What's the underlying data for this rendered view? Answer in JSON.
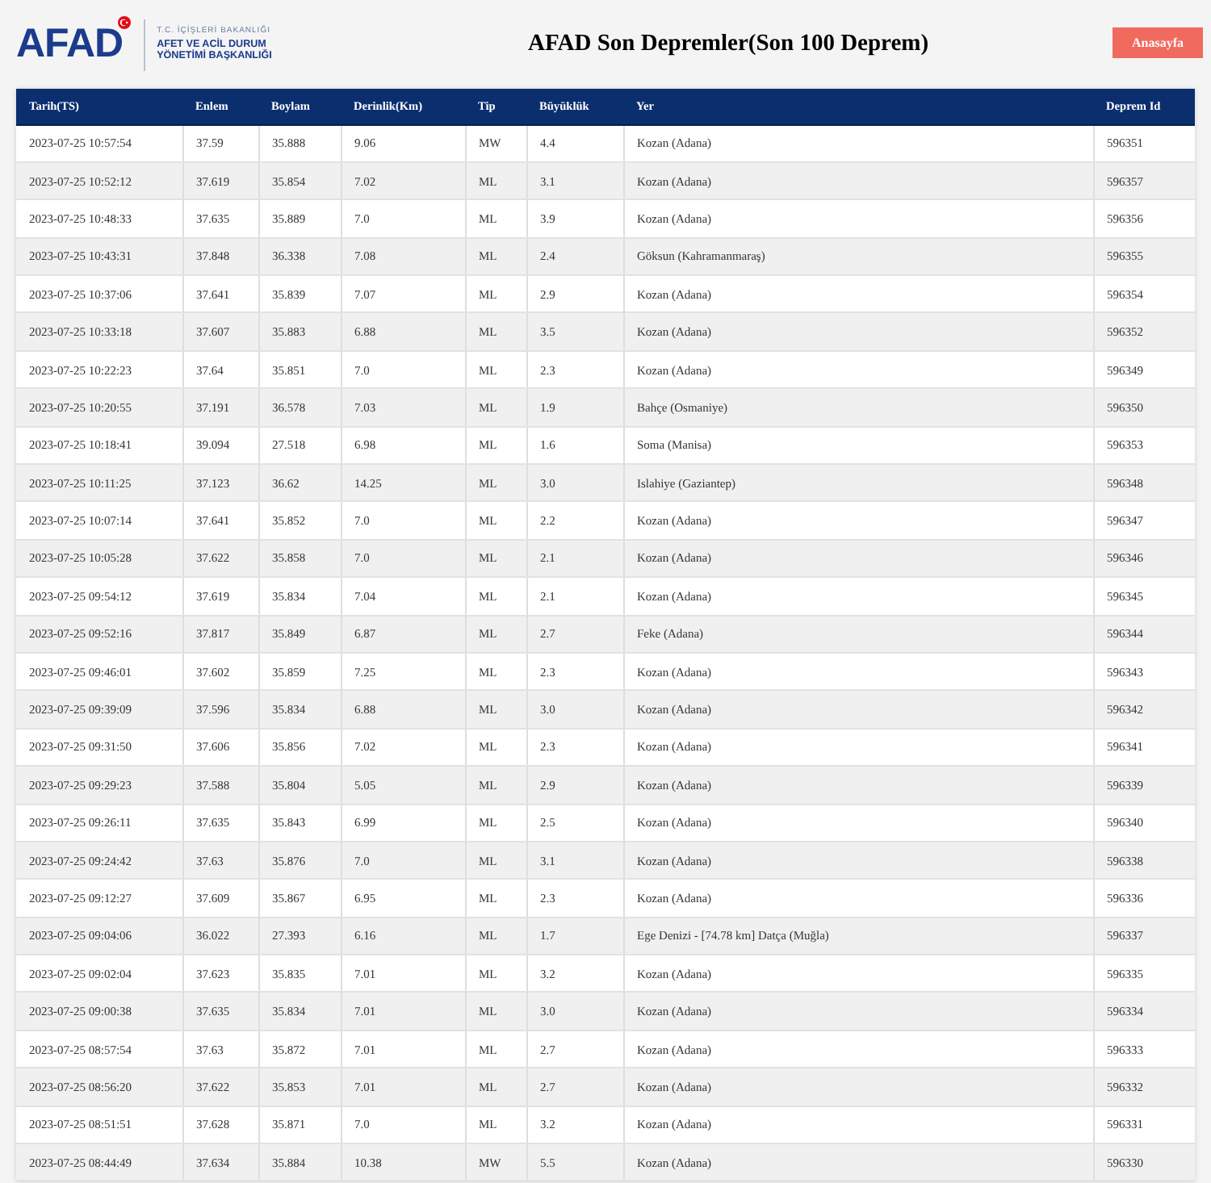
{
  "logo": {
    "wordmark": "AFAD",
    "ministry": "T.C. İÇİŞLERİ BAKANLIĞI",
    "agency": [
      "AFET VE ACİL DURUM",
      "YÖNETİMİ BAŞKANLIĞI"
    ]
  },
  "title": "AFAD Son Depremler(Son 100 Deprem)",
  "home_button": "Anasayfa",
  "table": {
    "columns": [
      "Tarih(TS)",
      "Enlem",
      "Boylam",
      "Derinlik(Km)",
      "Tip",
      "Büyüklük",
      "Yer",
      "Deprem Id"
    ],
    "rows": [
      [
        "2023-07-25 10:57:54",
        "37.59",
        "35.888",
        "9.06",
        "MW",
        "4.4",
        "Kozan (Adana)",
        "596351"
      ],
      [
        "2023-07-25 10:52:12",
        "37.619",
        "35.854",
        "7.02",
        "ML",
        "3.1",
        "Kozan (Adana)",
        "596357"
      ],
      [
        "2023-07-25 10:48:33",
        "37.635",
        "35.889",
        "7.0",
        "ML",
        "3.9",
        "Kozan (Adana)",
        "596356"
      ],
      [
        "2023-07-25 10:43:31",
        "37.848",
        "36.338",
        "7.08",
        "ML",
        "2.4",
        "Göksun (Kahramanmaraş)",
        "596355"
      ],
      [
        "2023-07-25 10:37:06",
        "37.641",
        "35.839",
        "7.07",
        "ML",
        "2.9",
        "Kozan (Adana)",
        "596354"
      ],
      [
        "2023-07-25 10:33:18",
        "37.607",
        "35.883",
        "6.88",
        "ML",
        "3.5",
        "Kozan (Adana)",
        "596352"
      ],
      [
        "2023-07-25 10:22:23",
        "37.64",
        "35.851",
        "7.0",
        "ML",
        "2.3",
        "Kozan (Adana)",
        "596349"
      ],
      [
        "2023-07-25 10:20:55",
        "37.191",
        "36.578",
        "7.03",
        "ML",
        "1.9",
        "Bahçe (Osmaniye)",
        "596350"
      ],
      [
        "2023-07-25 10:18:41",
        "39.094",
        "27.518",
        "6.98",
        "ML",
        "1.6",
        "Soma (Manisa)",
        "596353"
      ],
      [
        "2023-07-25 10:11:25",
        "37.123",
        "36.62",
        "14.25",
        "ML",
        "3.0",
        "Islahiye (Gaziantep)",
        "596348"
      ],
      [
        "2023-07-25 10:07:14",
        "37.641",
        "35.852",
        "7.0",
        "ML",
        "2.2",
        "Kozan (Adana)",
        "596347"
      ],
      [
        "2023-07-25 10:05:28",
        "37.622",
        "35.858",
        "7.0",
        "ML",
        "2.1",
        "Kozan (Adana)",
        "596346"
      ],
      [
        "2023-07-25 09:54:12",
        "37.619",
        "35.834",
        "7.04",
        "ML",
        "2.1",
        "Kozan (Adana)",
        "596345"
      ],
      [
        "2023-07-25 09:52:16",
        "37.817",
        "35.849",
        "6.87",
        "ML",
        "2.7",
        "Feke (Adana)",
        "596344"
      ],
      [
        "2023-07-25 09:46:01",
        "37.602",
        "35.859",
        "7.25",
        "ML",
        "2.3",
        "Kozan (Adana)",
        "596343"
      ],
      [
        "2023-07-25 09:39:09",
        "37.596",
        "35.834",
        "6.88",
        "ML",
        "3.0",
        "Kozan (Adana)",
        "596342"
      ],
      [
        "2023-07-25 09:31:50",
        "37.606",
        "35.856",
        "7.02",
        "ML",
        "2.3",
        "Kozan (Adana)",
        "596341"
      ],
      [
        "2023-07-25 09:29:23",
        "37.588",
        "35.804",
        "5.05",
        "ML",
        "2.9",
        "Kozan (Adana)",
        "596339"
      ],
      [
        "2023-07-25 09:26:11",
        "37.635",
        "35.843",
        "6.99",
        "ML",
        "2.5",
        "Kozan (Adana)",
        "596340"
      ],
      [
        "2023-07-25 09:24:42",
        "37.63",
        "35.876",
        "7.0",
        "ML",
        "3.1",
        "Kozan (Adana)",
        "596338"
      ],
      [
        "2023-07-25 09:12:27",
        "37.609",
        "35.867",
        "6.95",
        "ML",
        "2.3",
        "Kozan (Adana)",
        "596336"
      ],
      [
        "2023-07-25 09:04:06",
        "36.022",
        "27.393",
        "6.16",
        "ML",
        "1.7",
        "Ege Denizi - [74.78 km] Datça (Muğla)",
        "596337"
      ],
      [
        "2023-07-25 09:02:04",
        "37.623",
        "35.835",
        "7.01",
        "ML",
        "3.2",
        "Kozan (Adana)",
        "596335"
      ],
      [
        "2023-07-25 09:00:38",
        "37.635",
        "35.834",
        "7.01",
        "ML",
        "3.0",
        "Kozan (Adana)",
        "596334"
      ],
      [
        "2023-07-25 08:57:54",
        "37.63",
        "35.872",
        "7.01",
        "ML",
        "2.7",
        "Kozan (Adana)",
        "596333"
      ],
      [
        "2023-07-25 08:56:20",
        "37.622",
        "35.853",
        "7.01",
        "ML",
        "2.7",
        "Kozan (Adana)",
        "596332"
      ],
      [
        "2023-07-25 08:51:51",
        "37.628",
        "35.871",
        "7.0",
        "ML",
        "3.2",
        "Kozan (Adana)",
        "596331"
      ],
      [
        "2023-07-25 08:44:49",
        "37.634",
        "35.884",
        "10.38",
        "MW",
        "5.5",
        "Kozan (Adana)",
        "596330"
      ]
    ]
  }
}
